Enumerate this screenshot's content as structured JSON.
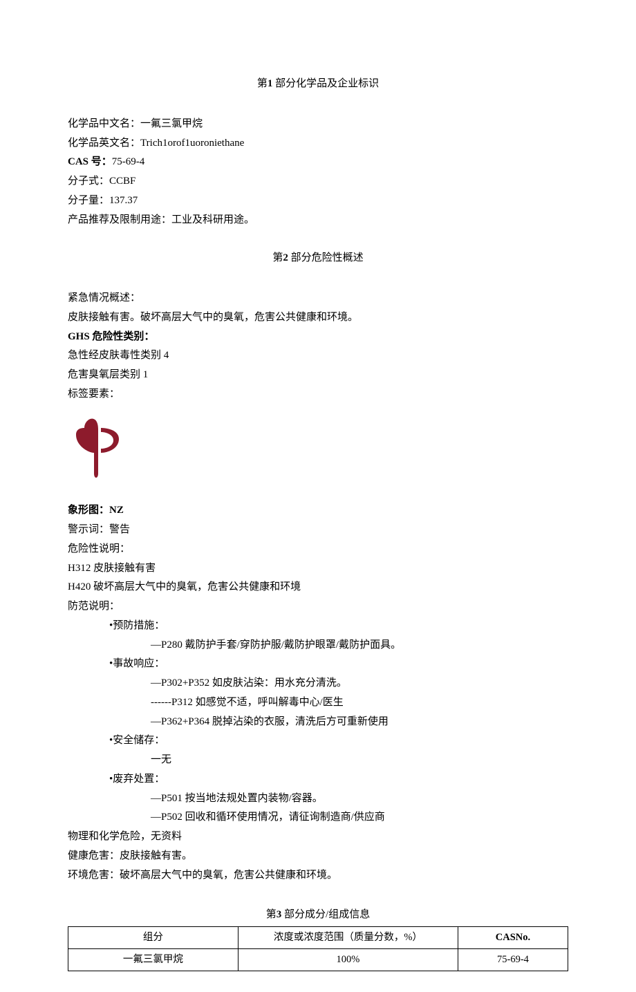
{
  "section1": {
    "title_pre": "第",
    "title_num": "1",
    "title_post": " 部分化学品及企业标识",
    "name_zh_label": "化学品中文名：",
    "name_zh": "一氟三氯甲烷",
    "name_en_label": "化学品英文名：",
    "name_en": "Trich1orof1uoroniethane",
    "cas_label": "CAS 号：",
    "cas": "75-69-4",
    "formula_label": "分子式：",
    "formula": "CCBF",
    "mw_label": "分子量：",
    "mw": "137.37",
    "use_label": "产品推荐及限制用途：",
    "use": "工业及科研用途。"
  },
  "section2": {
    "title_pre": "第",
    "title_num": "2",
    "title_post": " 部分危险性概述",
    "emergency_label": "紧急情况概述：",
    "emergency": "皮肤接触有害。破坏高层大气中的臭氧，危害公共健康和环境。",
    "ghs_label": "GHS 危险性类别：",
    "ghs_line1": "急性经皮肤毒性类别 4",
    "ghs_line2": "危害臭氧层类别 1",
    "label_elements": "标签要素：",
    "pictogram_label": "象形图：",
    "pictogram_code": "NZ",
    "signal_label": "警示词：",
    "signal": "警告",
    "hazard_label": "危险性说明：",
    "h312": "H312 皮肤接触有害",
    "h420": "H420 破坏高层大气中的臭氧，危害公共健康和环境",
    "precaution_label": "防范说明：",
    "prevention_label": "•预防措施：",
    "p280": "—P280 戴防护手套/穿防护服/戴防护眼罩/戴防护面具。",
    "response_label": "•事故响应：",
    "p302": "—P302+P352 如皮肤沾染：用水充分清洗。",
    "p312": "------P312 如感觉不适，呼叫解毒中心/医生",
    "p362": "—P362+P364 脱掉沾染的衣服，清洗后方可重新使用",
    "storage_label": "•安全储存：",
    "storage_none": "一无",
    "disposal_label": "•废弃处置：",
    "p501": "—P501 按当地法规处置内装物/容器。",
    "p502": "—P502 回收和循环使用情况，请征询制造商/供应商",
    "physchem": "物理和化学危险，无资料",
    "health_label": "健康危害：",
    "health": "皮肤接触有害。",
    "env_label": "环境危害：",
    "env": "破坏高层大气中的臭氧，危害公共健康和环境。"
  },
  "section3": {
    "title_pre": "第",
    "title_num": "3",
    "title_post": " 部分成分/组成信息",
    "headers": {
      "component": "组分",
      "concentration": "浓度或浓度范围（质量分数，%）",
      "cas": "CASNo."
    },
    "row": {
      "component": "一氟三氯甲烷",
      "concentration": "100%",
      "cas": "75-69-4"
    }
  }
}
